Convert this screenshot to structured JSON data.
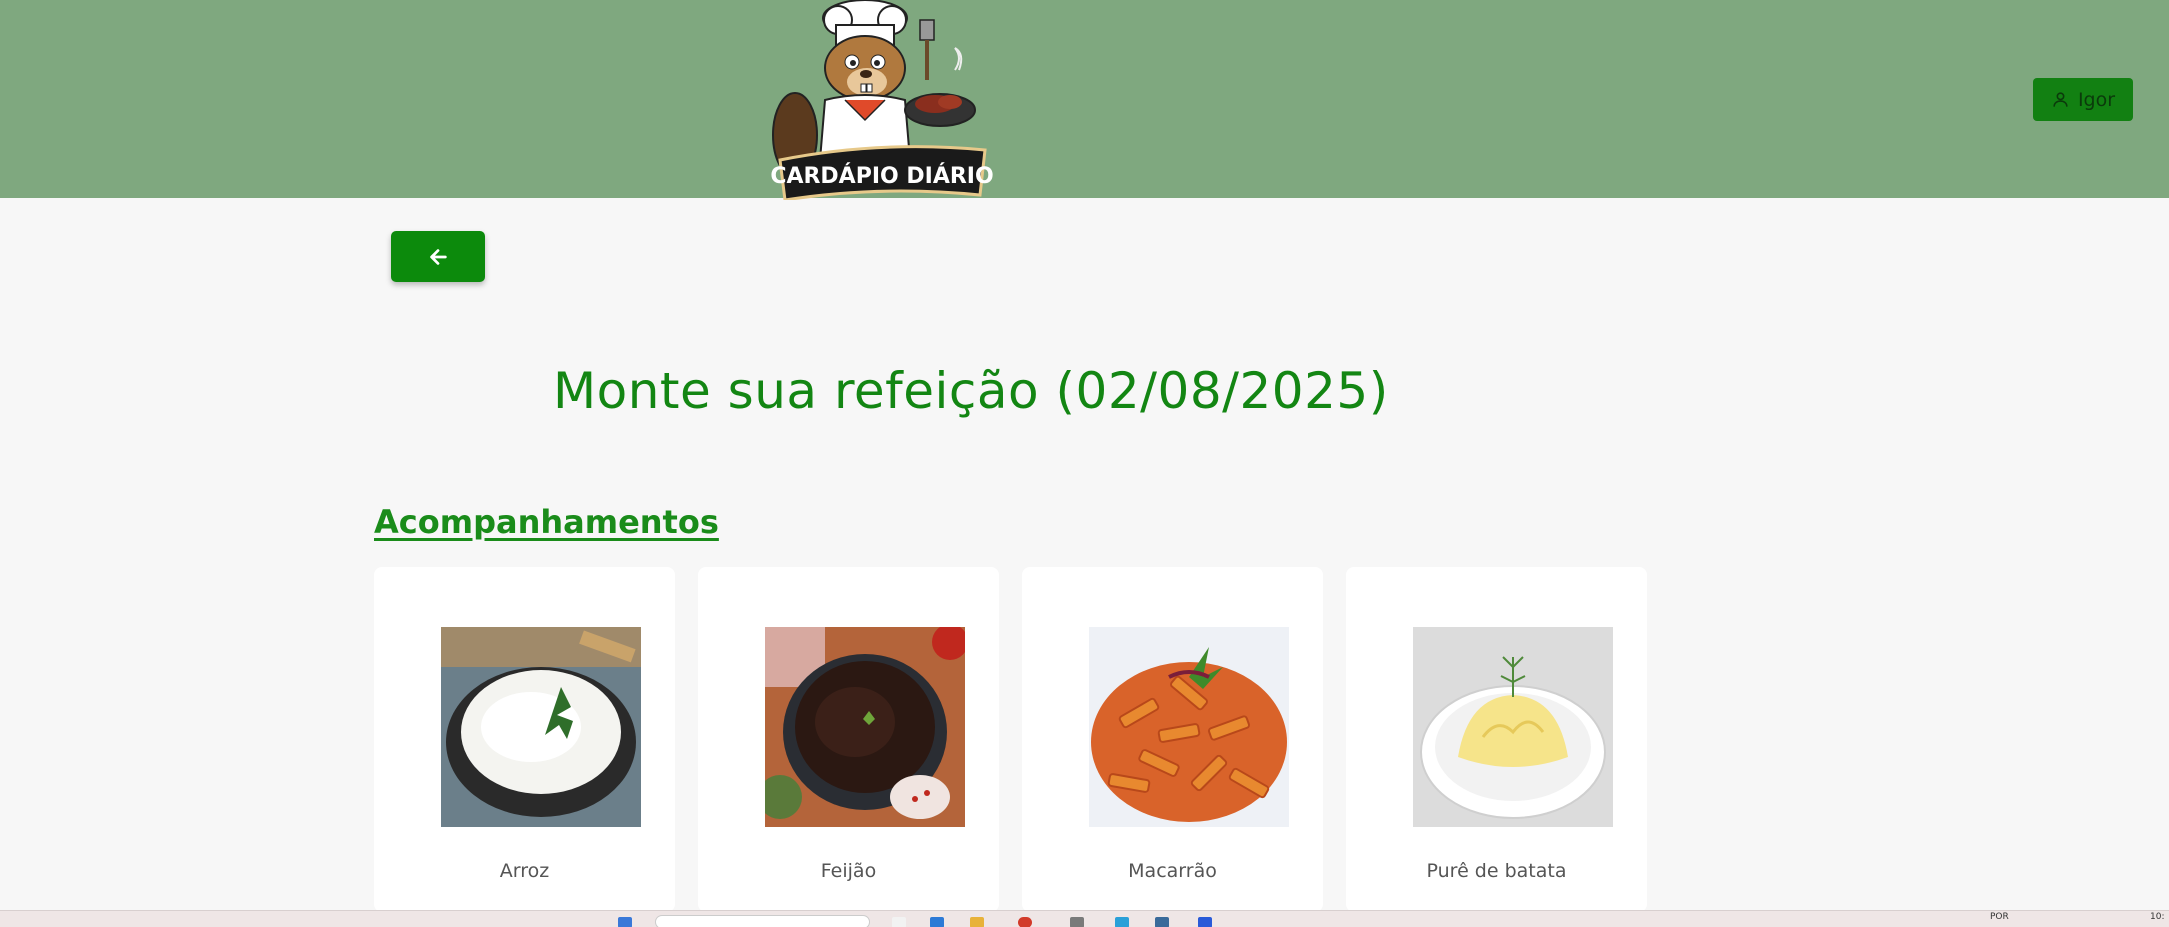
{
  "header": {
    "logo_text": "CARDÁPIO DIÁRIO",
    "user_name": "Igor"
  },
  "page": {
    "title": "Monte sua refeição (02/08/2025)"
  },
  "sections": [
    {
      "title": "Acompanhamentos",
      "items": [
        {
          "label": "Arroz",
          "image": "rice-bowl"
        },
        {
          "label": "Feijão",
          "image": "black-beans-pot"
        },
        {
          "label": "Macarrão",
          "image": "penne-pasta"
        },
        {
          "label": "Purê de batata",
          "image": "mashed-potato"
        }
      ]
    }
  ],
  "colors": {
    "header_bg": "#7fa87f",
    "accent_green": "#0c8a0c",
    "title_green": "#138613",
    "page_bg": "#f7f7f7"
  },
  "taskbar": {
    "language": "POR",
    "clock": "10:"
  }
}
